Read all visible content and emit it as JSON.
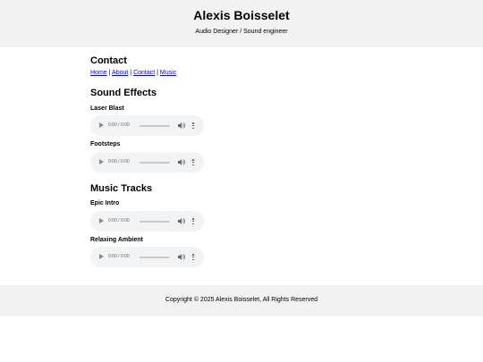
{
  "header": {
    "title": "Alexis Boisselet",
    "subtitle": "Audio Designer / Sound engineer"
  },
  "contact": {
    "heading": "Contact",
    "nav": [
      "Home",
      "About",
      "Contact",
      "Music"
    ],
    "separator": "|"
  },
  "sound_effects": {
    "heading": "Sound Effects",
    "tracks": [
      {
        "title": "Laser Blast",
        "time": "0:00 / 0:00",
        "progress": 0
      },
      {
        "title": "Footsteps",
        "time": "0:00 / 0:00",
        "progress": 0
      }
    ]
  },
  "music_tracks": {
    "heading": "Music Tracks",
    "tracks": [
      {
        "title": "Epic Intro",
        "time": "0:00 / 0:00",
        "progress": 0
      },
      {
        "title": "Relaxing Ambient",
        "time": "0:00 / 0:00",
        "progress": 0
      }
    ]
  },
  "icons": {
    "play": "play-icon",
    "volume": "volume-icon",
    "menu": "more-options-icon"
  },
  "colors": {
    "header_background": "#f2f2f2",
    "link": "#0000ee",
    "player_background": "#f1f3f4"
  },
  "footer": {
    "copyright": "Copyright © 2025 Alexis Boisselet, All Rights Reserved"
  }
}
